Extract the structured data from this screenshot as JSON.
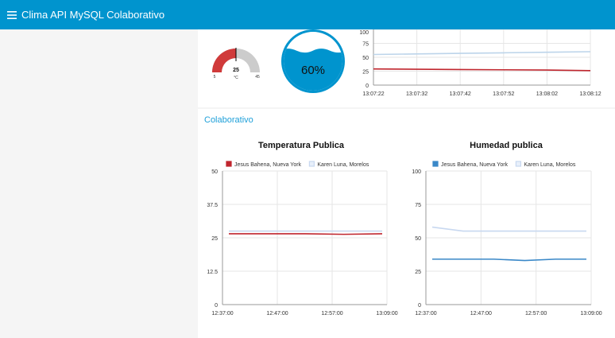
{
  "header": {
    "title": "Clima API MySQL Colaborativo",
    "menu_icon": "hamburger-menu-icon"
  },
  "gauge": {
    "value": "25",
    "unit": "°C",
    "min": "5",
    "max": "45",
    "fill_color": "#d03a3a"
  },
  "humidity_tank": {
    "label": "60%",
    "level": 0.6,
    "water_color": "#0094ce"
  },
  "group": {
    "title": "Colaborativo"
  },
  "chart_data": [
    {
      "type": "line",
      "title": "",
      "x": [
        "13:07:22",
        "13:07:32",
        "13:07:42",
        "13:07:52",
        "13:08:02",
        "13:08:12"
      ],
      "yticks": [
        "100",
        "75",
        "50",
        "25",
        "0"
      ],
      "ylim": [
        0,
        100
      ],
      "series": [
        {
          "color": "#bcd4ea",
          "values": [
            55,
            56,
            57,
            58,
            59,
            60
          ]
        },
        {
          "color": "#c0262e",
          "values": [
            29,
            28.5,
            28,
            27.5,
            27,
            26
          ]
        }
      ]
    },
    {
      "type": "line",
      "title": "Temperatura Publica",
      "x": [
        "12:37:00",
        "12:47:00",
        "12:57:00",
        "13:09:00"
      ],
      "yticks": [
        "50",
        "37.5",
        "25",
        "12.5",
        "0"
      ],
      "ylim": [
        0,
        50
      ],
      "series": [
        {
          "name": "Jesus Bahena, Nueva York",
          "color": "#c0262e",
          "values": [
            26.5,
            26.5,
            26.5,
            26.3,
            26.5
          ]
        },
        {
          "name": "Karen Luna, Morelos",
          "color": "#c8d8f0",
          "values": [
            27.5,
            27.5,
            27.5,
            27.5,
            27.5
          ]
        }
      ]
    },
    {
      "type": "line",
      "title": "Humedad publica",
      "x": [
        "12:37:00",
        "12:47:00",
        "12:57:00",
        "13:09:00"
      ],
      "yticks": [
        "100",
        "75",
        "50",
        "25",
        "0"
      ],
      "ylim": [
        0,
        100
      ],
      "series": [
        {
          "name": "Jesus Bahena, Nueva York",
          "color": "#3a88c8",
          "values": [
            34,
            34,
            34,
            33,
            34,
            34
          ]
        },
        {
          "name": "Karen Luna, Morelos",
          "color": "#c8d8f0",
          "values": [
            58,
            55,
            55,
            55,
            55,
            55
          ]
        }
      ]
    }
  ]
}
